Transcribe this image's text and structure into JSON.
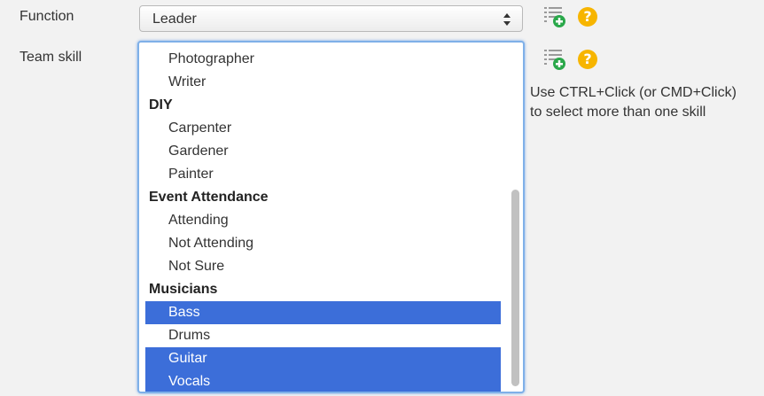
{
  "form": {
    "function_label": "Function",
    "function_value": "Leader",
    "team_skill_label": "Team skill",
    "hint": "Use CTRL+Click (or CMD+Click) to select more than one skill"
  },
  "skills": {
    "options": [
      {
        "label": "Photographer",
        "group": false,
        "selected": false
      },
      {
        "label": "Writer",
        "group": false,
        "selected": false
      },
      {
        "label": "DIY",
        "group": true,
        "selected": false
      },
      {
        "label": "Carpenter",
        "group": false,
        "selected": false
      },
      {
        "label": "Gardener",
        "group": false,
        "selected": false
      },
      {
        "label": "Painter",
        "group": false,
        "selected": false
      },
      {
        "label": "Event Attendance",
        "group": true,
        "selected": false
      },
      {
        "label": "Attending",
        "group": false,
        "selected": false
      },
      {
        "label": "Not Attending",
        "group": false,
        "selected": false
      },
      {
        "label": "Not Sure",
        "group": false,
        "selected": false
      },
      {
        "label": "Musicians",
        "group": true,
        "selected": false
      },
      {
        "label": "Bass",
        "group": false,
        "selected": true
      },
      {
        "label": "Drums",
        "group": false,
        "selected": false
      },
      {
        "label": "Guitar",
        "group": false,
        "selected": true
      },
      {
        "label": "Vocals",
        "group": false,
        "selected": true
      }
    ]
  },
  "icons": {
    "add": "add-list-icon",
    "help": "help-icon",
    "help_glyph": "?"
  },
  "colors": {
    "selected_bg": "#3c6ed9",
    "focus_border": "#7fb0e8",
    "help_bg": "#f7b500",
    "add_green": "#2aa84a"
  }
}
